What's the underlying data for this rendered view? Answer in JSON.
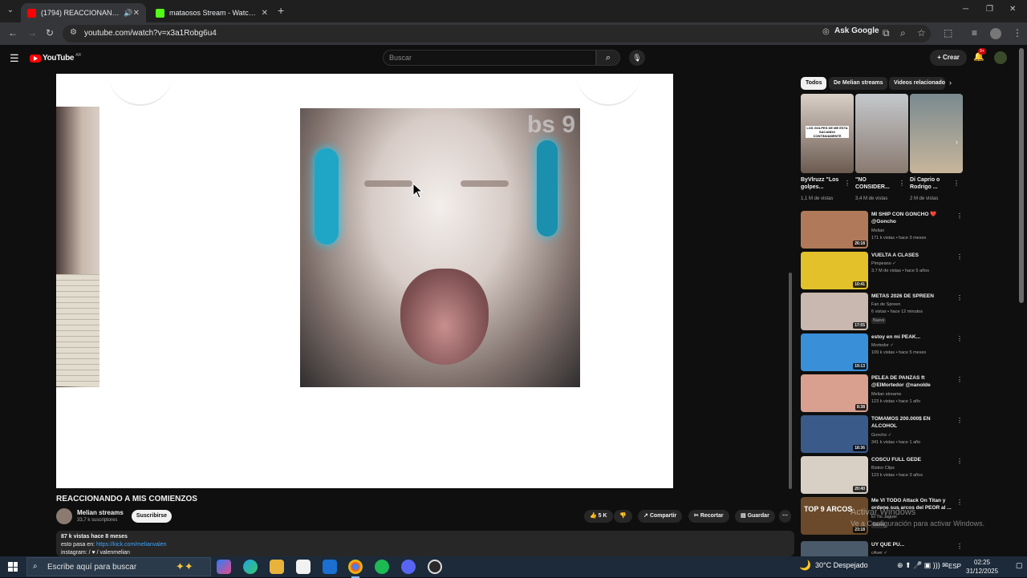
{
  "browser": {
    "tabs": [
      {
        "title": "(1794) REACCIONANDO A MIS COMIENZOS - YouTube",
        "favicon_color": "#ff0000",
        "active": true
      },
      {
        "title": "mataosos Stream - Watch Live on Kick",
        "favicon_color": "#53fc18",
        "active": false
      }
    ],
    "url": "youtube.com/watch?v=x3a1Robg6u4",
    "ask_google": "Ask Google"
  },
  "youtube": {
    "logo_text": "YouTube",
    "logo_country": "AR",
    "search_placeholder": "Buscar",
    "create_label": "Crear",
    "notifications_badge": "9+"
  },
  "video": {
    "title": "REACCIONANDO A MIS COMIENZOS",
    "channel": "Melian streams",
    "subscribers": "33,7 k suscriptores",
    "subscribe_label": "Suscribirse",
    "likes": "5 K",
    "share_label": "Compartir",
    "clip_label": "Recortar",
    "save_label": "Guardar",
    "overlay_text": "bs 9",
    "description": {
      "stats": "87 k vistas  hace 8 meses",
      "line2_prefix": "esto pasa en:  ",
      "line2_link": "https://kick.com/melianvalen",
      "line3": "instagram:  /  ♥ / valenmelian"
    }
  },
  "sidebar": {
    "chips": [
      "Todos",
      "De Melian streams",
      "Videos relacionados"
    ],
    "shorts": [
      {
        "title": "ByVlruzz \"Los golpes...",
        "views": "1,1 M de vistas",
        "caption": "LOS GOLPES DE ME ESTA SACANDO CONTINUAMENTE"
      },
      {
        "title": "\"NO CONSIDER...",
        "views": "3,4 M de vistas"
      },
      {
        "title": "Di Caprio o Rodrigo ...",
        "views": "2 M de vistas"
      }
    ],
    "videos": [
      {
        "title": "MI SHIP CON GONCHO ❤️ @Goncho",
        "channel": "Melian",
        "views": "171 k vistas • hace 3 meses",
        "duration": "26:18",
        "thumb": "#b07a5a",
        "badge": ""
      },
      {
        "title": "VUELTA A CLASES",
        "channel": "Pimpeano ✓",
        "views": "3,7 M de vistas • hace 5 años",
        "duration": "10:41",
        "thumb": "#e2c12a",
        "badge": ""
      },
      {
        "title": "METAS 2026 DE SPREEN",
        "channel": "Fan de Spreen",
        "views": "6 vistas • hace 12 minutos",
        "duration": "17:55",
        "thumb": "#c9b8b0",
        "badge": "Nuevo"
      },
      {
        "title": "estoy en mi PEAK...",
        "channel": "Mortedor ✓",
        "views": "109 k vistas • hace 5 meses",
        "duration": "19:13",
        "thumb": "#3a8fd9",
        "badge": ""
      },
      {
        "title": "PELEA DE PANZAS ft @ElMortedor @nanolde",
        "channel": "Melian streams",
        "views": "123 k vistas • hace 1 año",
        "duration": "8:38",
        "thumb": "#d9a090",
        "badge": ""
      },
      {
        "title": "TOMAMOS 200.000$ EN ALCOHOL",
        "channel": "Goncho ✓",
        "views": "341 k vistas • hace 1 año",
        "duration": "18:36",
        "thumb": "#3a5a8a",
        "badge": ""
      },
      {
        "title": "COSCU FULL GEDE",
        "channel": "Bistior Clips",
        "views": "123 k vistas • hace 3 años",
        "duration": "20:40",
        "thumb": "#d8d0c4",
        "badge": ""
      },
      {
        "title": "Me VI TODO Attack On Titan y ordene sus arcos del PEOR al ...",
        "channel": "El Tio Jaguer",
        "views": "",
        "duration": "23:18",
        "thumb": "#6a4a2a",
        "badge": "Nuevo",
        "overlay": "TOP 9 ARCOS"
      },
      {
        "title": "UY QUE PU...",
        "channel": "cAver ✓",
        "views": "",
        "duration": "",
        "thumb": "#4a5a6a",
        "badge": ""
      }
    ]
  },
  "windows_watermark": {
    "line1": "Activar Windows",
    "line2": "Ve a Configuración para activar Windows."
  },
  "taskbar": {
    "search_placeholder": "Escribe aquí para buscar",
    "weather": "30°C  Despejado",
    "language": "ESP",
    "time": "02:25",
    "date": "31/12/2025"
  }
}
